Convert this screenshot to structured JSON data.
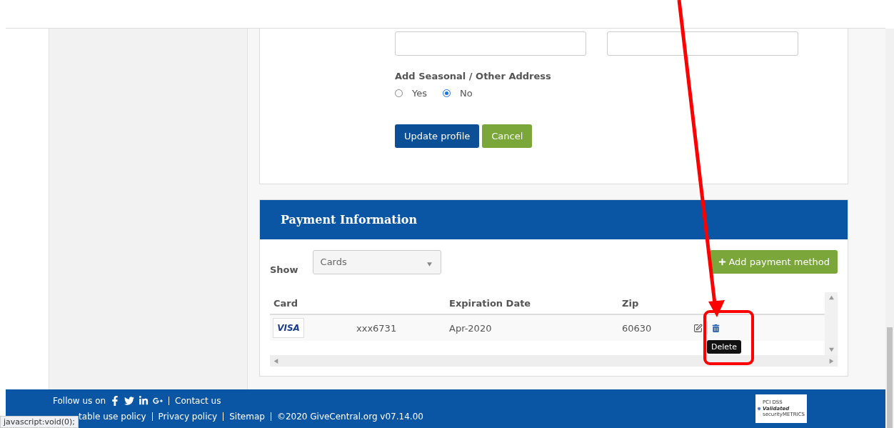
{
  "profile_form": {
    "seasonal_label": "Add Seasonal / Other Address",
    "options": [
      {
        "label": "Yes",
        "selected": false
      },
      {
        "label": "No",
        "selected": true
      }
    ],
    "buttons": [
      {
        "label": "Update profile",
        "kind": "primary"
      },
      {
        "label": "Cancel",
        "kind": "secondary"
      }
    ]
  },
  "payment": {
    "title": "Payment Information",
    "show_label": "Show",
    "show_value": "Cards",
    "add_button": "Add payment method",
    "columns": [
      "Card",
      "",
      "Expiration Date",
      "Zip"
    ],
    "rows": [
      {
        "brand": "VISA",
        "number": "xxx6731",
        "expiration": "Apr-2020",
        "zip": "60630"
      }
    ],
    "tooltip": "Delete"
  },
  "footer": {
    "follow": "Follow us on",
    "contact": "Contact us",
    "links": [
      "table use policy",
      "Privacy policy",
      "Sitemap"
    ],
    "copyright": "©2020 GiveCentral.org v07.14.00",
    "badge": {
      "line1": "PCI DSS",
      "line2": "Validated",
      "line3": "securityMETRICS"
    }
  },
  "status_bar": "javascript:void(0);"
}
